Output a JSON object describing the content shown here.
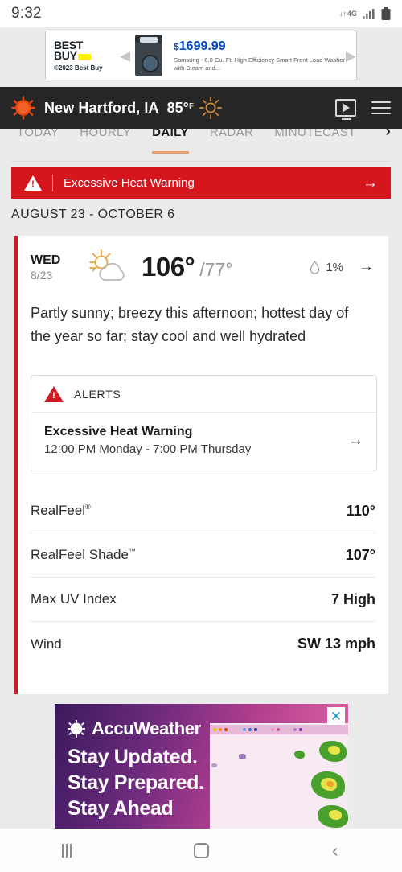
{
  "status_bar": {
    "time": "9:32",
    "network_label": "4G",
    "network_arrows": "↓↑",
    "signal_icon": "signal-bars-icon",
    "battery_icon": "battery-full-icon"
  },
  "top_ad": {
    "brand_line1": "BEST",
    "brand_line2": "BUY",
    "copyright": "©2023 Best Buy",
    "price": "1699.99",
    "currency": "$",
    "description": "Samsung - 6.0 Cu. Ft. High Efficiency Smart Front Load Washer with Steam and...",
    "prev_arrow": "◀",
    "next_arrow": "▶",
    "product_icon": "washing-machine-image"
  },
  "header": {
    "logo_icon": "accuweather-sun-logo",
    "location": "New Hartford, IA",
    "temperature": "85°",
    "unit": "F",
    "condition_icon": "sunny-icon",
    "video_icon": "video-play-icon",
    "menu_icon": "hamburger-menu-icon"
  },
  "tabs": {
    "items": [
      {
        "label": "TODAY",
        "active": false
      },
      {
        "label": "HOURLY",
        "active": false
      },
      {
        "label": "DAILY",
        "active": true
      },
      {
        "label": "RADAR",
        "active": false
      },
      {
        "label": "MINUTECAST",
        "active": false
      }
    ],
    "next_icon": "›"
  },
  "warning_banner": {
    "icon": "warning-triangle-icon",
    "text": "Excessive Heat Warning",
    "arrow": "→",
    "color": "#d5161c"
  },
  "date_range": "AUGUST 23 - OCTOBER 6",
  "forecast_card": {
    "accent_color": "#cc1b22",
    "day_name": "WED",
    "day_date": "8/23",
    "condition_icon": "partly-sunny-icon",
    "temp_high": "106°",
    "temp_low": "/77°",
    "precip_icon": "water-drop-icon",
    "precip_chance": "1%",
    "arrow": "→",
    "description": "Partly sunny; breezy this afternoon; hottest day of the year so far; stay cool and well hydrated",
    "alerts": {
      "icon": "alert-triangle-icon",
      "header": "ALERTS",
      "title": "Excessive Heat Warning",
      "timeframe": "12:00 PM Monday - 7:00 PM Thursday",
      "arrow": "→"
    },
    "details": [
      {
        "label": "RealFeel",
        "sup": "®",
        "value": "110°"
      },
      {
        "label": "RealFeel Shade",
        "sup": "™",
        "value": "107°"
      },
      {
        "label": "Max UV Index",
        "sup": "",
        "value": "7 High"
      },
      {
        "label": "Wind",
        "sup": "",
        "value": "SW 13 mph"
      }
    ]
  },
  "bottom_ad": {
    "brand": "AccuWeather",
    "brand_icon": "accuweather-sun-icon",
    "lines": [
      "Stay Updated.",
      "Stay Prepared.",
      "Stay Ahead"
    ],
    "map_icon": "radar-map-image",
    "close_icon": "✕"
  },
  "nav_bar": {
    "recent_icon": "recent-apps-icon",
    "home_icon": "home-icon",
    "back_icon": "‹"
  }
}
